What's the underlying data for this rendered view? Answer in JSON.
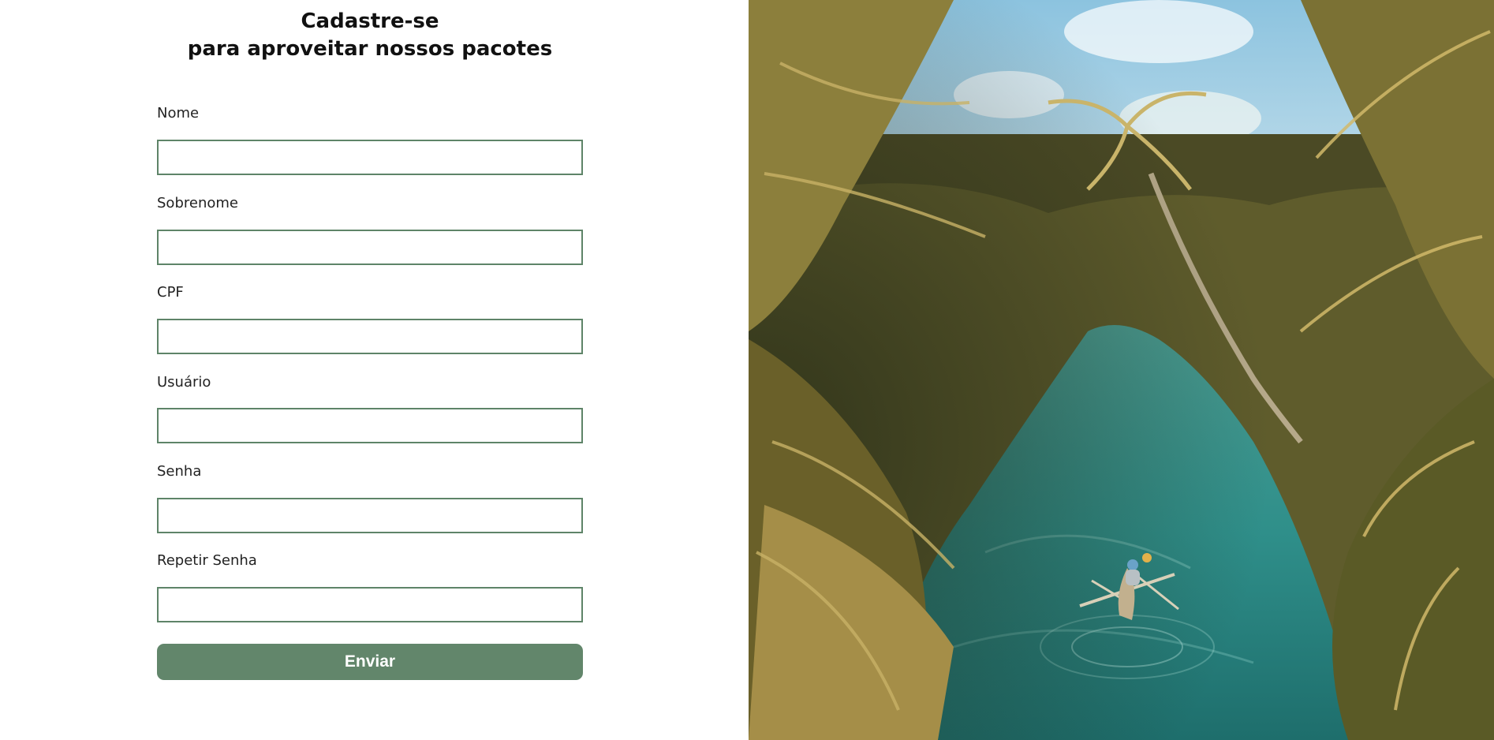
{
  "header": {
    "title_line1": "Cadastre-se",
    "title_line2": "para aproveitar nossos pacotes"
  },
  "form": {
    "fields": [
      {
        "label": "Nome",
        "value": "",
        "placeholder": ""
      },
      {
        "label": "Sobrenome",
        "value": "",
        "placeholder": ""
      },
      {
        "label": "CPF",
        "value": "",
        "placeholder": ""
      },
      {
        "label": "Usuário",
        "value": "",
        "placeholder": ""
      },
      {
        "label": "Senha",
        "value": "",
        "placeholder": ""
      },
      {
        "label": "Repetir Senha",
        "value": "",
        "placeholder": ""
      }
    ],
    "submit_label": "Enviar"
  },
  "colors": {
    "accent": "#62866b",
    "input_border": "#5e8468",
    "river": "#2f8f8a",
    "sky": "#9fd0e8",
    "foliage": "#7a7a3a"
  }
}
